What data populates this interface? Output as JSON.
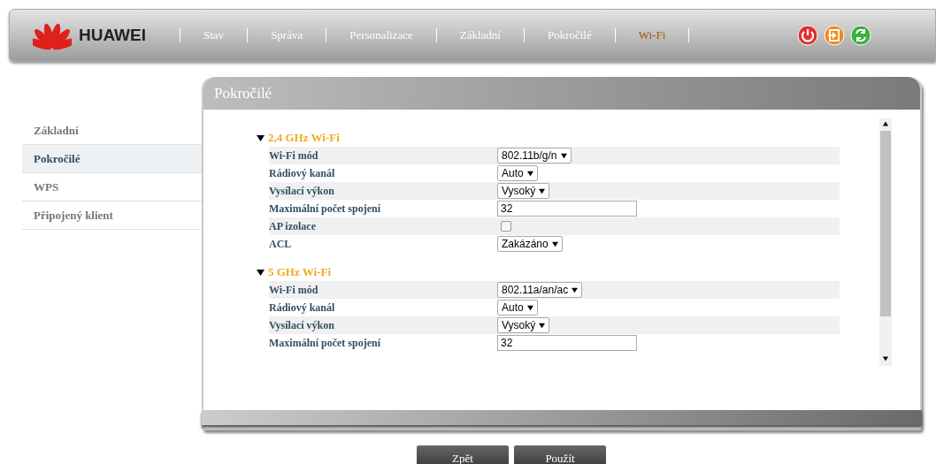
{
  "header": {
    "brand": "HUAWEI",
    "nav": [
      {
        "label": "Stav",
        "selected": false
      },
      {
        "label": "Správa",
        "selected": false
      },
      {
        "label": "Personalizace",
        "selected": false
      },
      {
        "label": "Základní",
        "selected": false
      },
      {
        "label": "Pokročilé",
        "selected": false
      },
      {
        "label": "Wi-Fi",
        "selected": true
      }
    ]
  },
  "sidebar": {
    "items": [
      {
        "label": "Základní",
        "selected": false
      },
      {
        "label": "Pokročilé",
        "selected": true
      },
      {
        "label": "WPS",
        "selected": false
      },
      {
        "label": "Připojený klient",
        "selected": false
      }
    ]
  },
  "panel": {
    "title": "Pokročilé",
    "sections": [
      {
        "title": "2,4 GHz Wi-Fi",
        "expanded": true,
        "rows": [
          {
            "label": "Wi-Fi mód",
            "kind": "select",
            "value": "802.11b/g/n"
          },
          {
            "label": "Rádiový kanál",
            "kind": "select",
            "value": "Auto"
          },
          {
            "label": "Vysílací výkon",
            "kind": "select",
            "value": "Vysoký"
          },
          {
            "label": "Maximální počet spojení",
            "kind": "text",
            "value": "32"
          },
          {
            "label": "AP izolace",
            "kind": "checkbox",
            "checked": false
          },
          {
            "label": "ACL",
            "kind": "select",
            "value": "Zakázáno"
          }
        ]
      },
      {
        "title": "5 GHz Wi-Fi",
        "expanded": true,
        "rows": [
          {
            "label": "Wi-Fi mód",
            "kind": "select",
            "value": "802.11a/an/ac"
          },
          {
            "label": "Rádiový kanál",
            "kind": "select",
            "value": "Auto"
          },
          {
            "label": "Vysílací výkon",
            "kind": "select",
            "value": "Vysoký"
          },
          {
            "label": "Maximální počet spojení",
            "kind": "text",
            "value": "32"
          }
        ]
      }
    ]
  },
  "buttons": [
    "Zpět",
    "Použít"
  ]
}
